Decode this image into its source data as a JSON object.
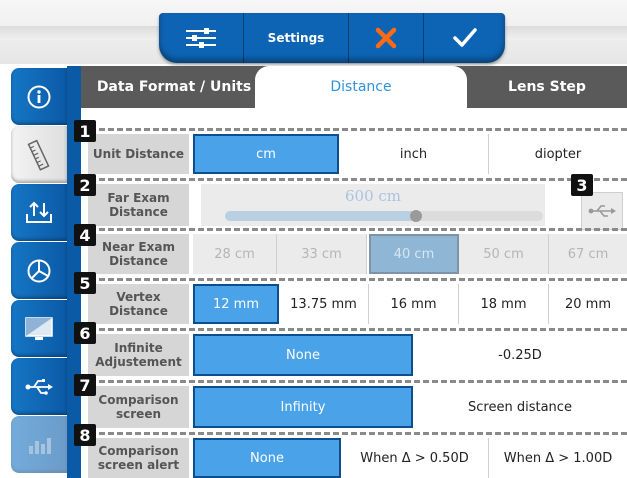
{
  "toolbar": {
    "title": "Settings"
  },
  "tabs": [
    {
      "label": "Data Format / Units"
    },
    {
      "label": "Distance"
    },
    {
      "label": "Lens Step"
    }
  ],
  "rows": {
    "unit": {
      "num": "1",
      "label": "Unit Distance",
      "options": [
        "cm",
        "inch",
        "diopter"
      ]
    },
    "far": {
      "num": "2",
      "label": "Far Exam Distance",
      "value": "600 cm",
      "slider_fraction": 0.6
    },
    "usb": {
      "num": "3"
    },
    "near": {
      "num": "4",
      "label": "Near Exam Distance",
      "options": [
        "28 cm",
        "33 cm",
        "40 cm",
        "50 cm",
        "67 cm"
      ]
    },
    "vertex": {
      "num": "5",
      "label": "Vertex Distance",
      "options": [
        "12 mm",
        "13.75 mm",
        "16 mm",
        "18 mm",
        "20 mm"
      ]
    },
    "infinite": {
      "num": "6",
      "label": "Infinite Adjustement",
      "options": [
        "None",
        "-0.25D"
      ]
    },
    "comparison": {
      "num": "7",
      "label": "Comparison screen",
      "options": [
        "Infinity",
        "Screen distance"
      ]
    },
    "alert": {
      "num": "8",
      "label": "Comparison screen alert",
      "options": [
        "None",
        "When Δ > 0.50D",
        "When Δ > 1.00D"
      ]
    }
  },
  "colors": {
    "accent": "#0e64b4",
    "selected": "#4aa3e8",
    "tab_active_text": "#2f93dc"
  }
}
